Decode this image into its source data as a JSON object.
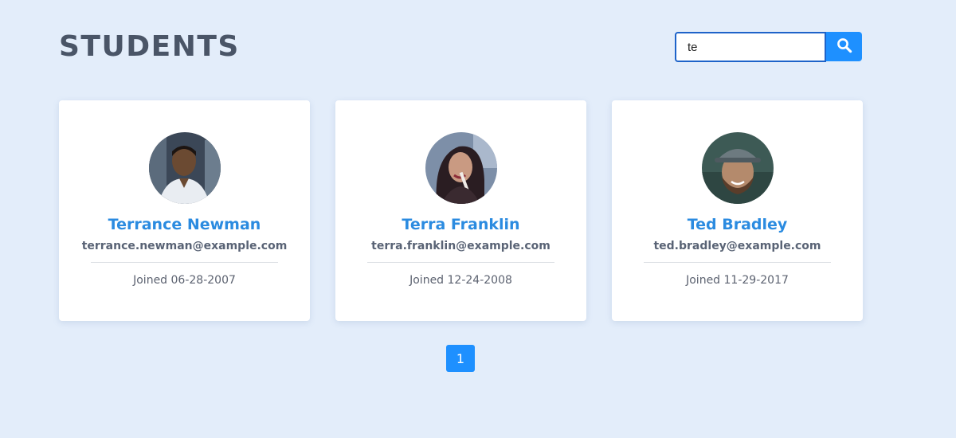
{
  "header": {
    "title": "STUDENTS"
  },
  "search": {
    "value": "te",
    "button_icon": "search-icon"
  },
  "students": [
    {
      "name": "Terrance Newman",
      "email": "terrance.newman@example.com",
      "joined": "Joined 06-28-2007",
      "avatar": "student-photo"
    },
    {
      "name": "Terra Franklin",
      "email": "terra.franklin@example.com",
      "joined": "Joined 12-24-2008",
      "avatar": "student-photo"
    },
    {
      "name": "Ted Bradley",
      "email": "ted.bradley@example.com",
      "joined": "Joined 11-29-2017",
      "avatar": "student-photo"
    }
  ],
  "pagination": {
    "pages": [
      "1"
    ],
    "active": "1"
  },
  "colors": {
    "background": "#e3edfa",
    "accent": "#1e90ff",
    "name": "#2b8be0",
    "title": "#4a5567"
  }
}
